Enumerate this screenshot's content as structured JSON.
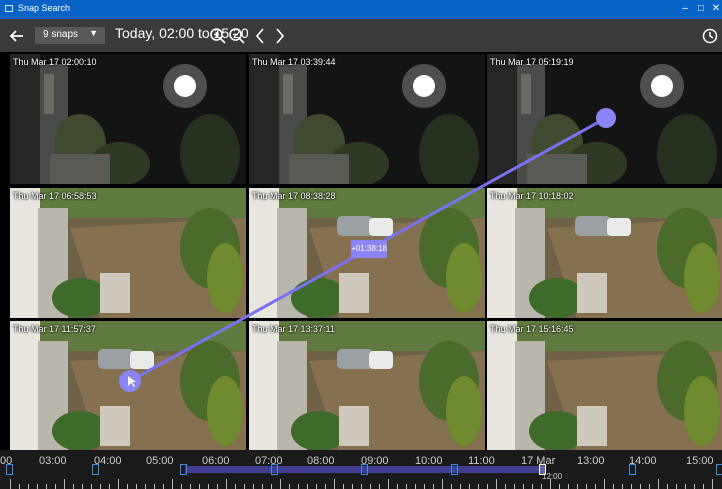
{
  "window": {
    "title": "Snap Search"
  },
  "toolbar": {
    "back_icon": "arrow-left-icon",
    "snaps_value": "9 snaps",
    "range_text": "Today, 02:00 to 15:20",
    "zoom_in_icon": "zoom-in-icon",
    "zoom_out_icon": "zoom-out-icon",
    "prev_icon": "chevron-left-icon",
    "next_icon": "chevron-right-icon",
    "history_icon": "clock-icon"
  },
  "snaps": [
    {
      "timestamp": "Thu Mar 17 02:00:10",
      "scene": "night"
    },
    {
      "timestamp": "Thu Mar 17 03:39:44",
      "scene": "night"
    },
    {
      "timestamp": "Thu Mar 17 05:19:19",
      "scene": "night"
    },
    {
      "timestamp": "Thu Mar 17 06:58:53",
      "scene": "day-empty"
    },
    {
      "timestamp": "Thu Mar 17 08:38:28",
      "scene": "day-car"
    },
    {
      "timestamp": "Thu Mar 17 10:18:02",
      "scene": "day-car"
    },
    {
      "timestamp": "Thu Mar 17 11:57:37",
      "scene": "day-car",
      "selected": true
    },
    {
      "timestamp": "Thu Mar 17 13:37:11",
      "scene": "day-car"
    },
    {
      "timestamp": "Thu Mar 17 15:16:45",
      "scene": "day-empty"
    }
  ],
  "overlay": {
    "duration_label": "+01:38:18",
    "accent": "#8a84f5"
  },
  "timeline": {
    "labels": [
      "00",
      "03:00",
      "04:00",
      "05:00",
      "06:00",
      "07:00",
      "08:00",
      "09:00",
      "10:00",
      "11:00",
      "17 Mar",
      "13:00",
      "14:00",
      "15:00"
    ],
    "sublabel": "12:00",
    "accent": "#3b8ee8"
  }
}
